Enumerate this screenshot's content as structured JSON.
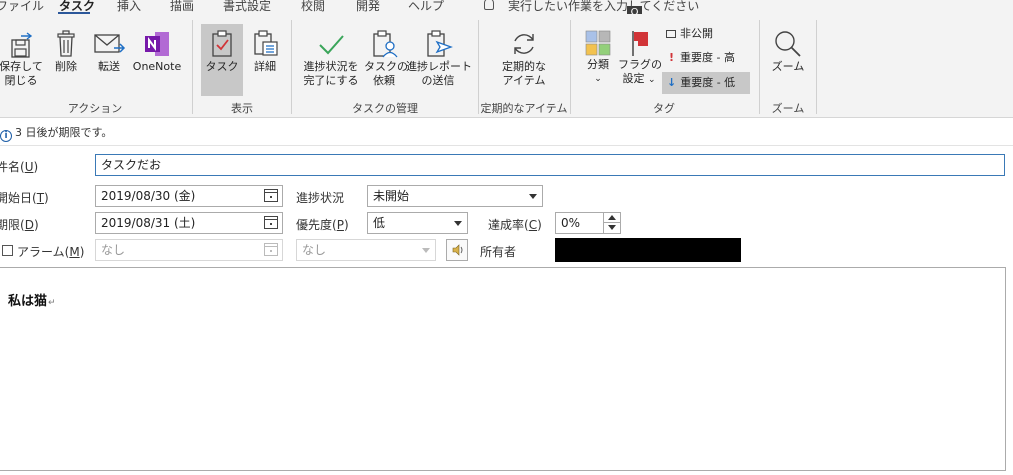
{
  "ribbon_tabs": [
    {
      "label": "ファイル",
      "keytip": "F"
    },
    {
      "label": "タスク",
      "keytip": "H"
    },
    {
      "label": "挿入",
      "keytip": "N"
    },
    {
      "label": "描画",
      "keytip": "JI"
    },
    {
      "label": "書式設定",
      "keytip": "O"
    },
    {
      "label": "校閲",
      "keytip": "V"
    },
    {
      "label": "開発",
      "keytip": "L"
    },
    {
      "label": "ヘルプ",
      "keytip": "E"
    }
  ],
  "tell_me": {
    "text": "実行したい作業を入力してください",
    "keytip": "Q"
  },
  "groups": {
    "actions": {
      "label": "アクション",
      "save_close_1": "保存して",
      "save_close_2": "閉じる",
      "delete": "削除",
      "forward": "転送",
      "onenote": "OneNote"
    },
    "show": {
      "label": "表示",
      "task": "タスク",
      "details": "詳細"
    },
    "manage": {
      "label": "タスクの管理",
      "mark_complete_1": "進捗状況を",
      "mark_complete_2": "完了にする",
      "assign_1": "タスクの",
      "assign_2": "依頼",
      "send_report_1": "進捗レポート",
      "send_report_2": "の送信"
    },
    "recurrence": {
      "label": "定期的なアイテム",
      "btn_1": "定期的な",
      "btn_2": "アイテム"
    },
    "tags": {
      "label": "タグ",
      "categorize": "分類",
      "followup_1": "フラグの",
      "followup_2": "設定",
      "private": "非公開",
      "high": "重要度 - 高",
      "low": "重要度 - 低"
    },
    "zoom": {
      "label": "ズーム",
      "btn": "ズーム"
    }
  },
  "info_text": "3 日後が期限です。",
  "form": {
    "subject_label": "件名(",
    "subject_key": "U",
    "subject_value": "タスクだお",
    "start_label": "開始日(",
    "start_key": "T",
    "start_value": "2019/08/30 (金)",
    "due_label": "期限(",
    "due_key": "D",
    "due_value": "2019/08/31 (土)",
    "status_label": "進捗状況",
    "status_value": "未開始",
    "priority_label": "優先度(",
    "priority_key": "P",
    "priority_value": "低",
    "complete_label": "達成率(",
    "complete_key": "C",
    "complete_value": "0%",
    "reminder_label": "アラーム(",
    "reminder_key": "M",
    "reminder_date": "なし",
    "reminder_time": "なし",
    "owner_label": "所有者",
    "close_paren": ")"
  },
  "body_text": "私は猫",
  "colors": {
    "accent": "#2b579a",
    "onenote": "#7719aa",
    "check_green": "#3aa55a",
    "flag_red": "#d13438",
    "high_red": "#d13438",
    "low_blue": "#1f6fc5"
  }
}
